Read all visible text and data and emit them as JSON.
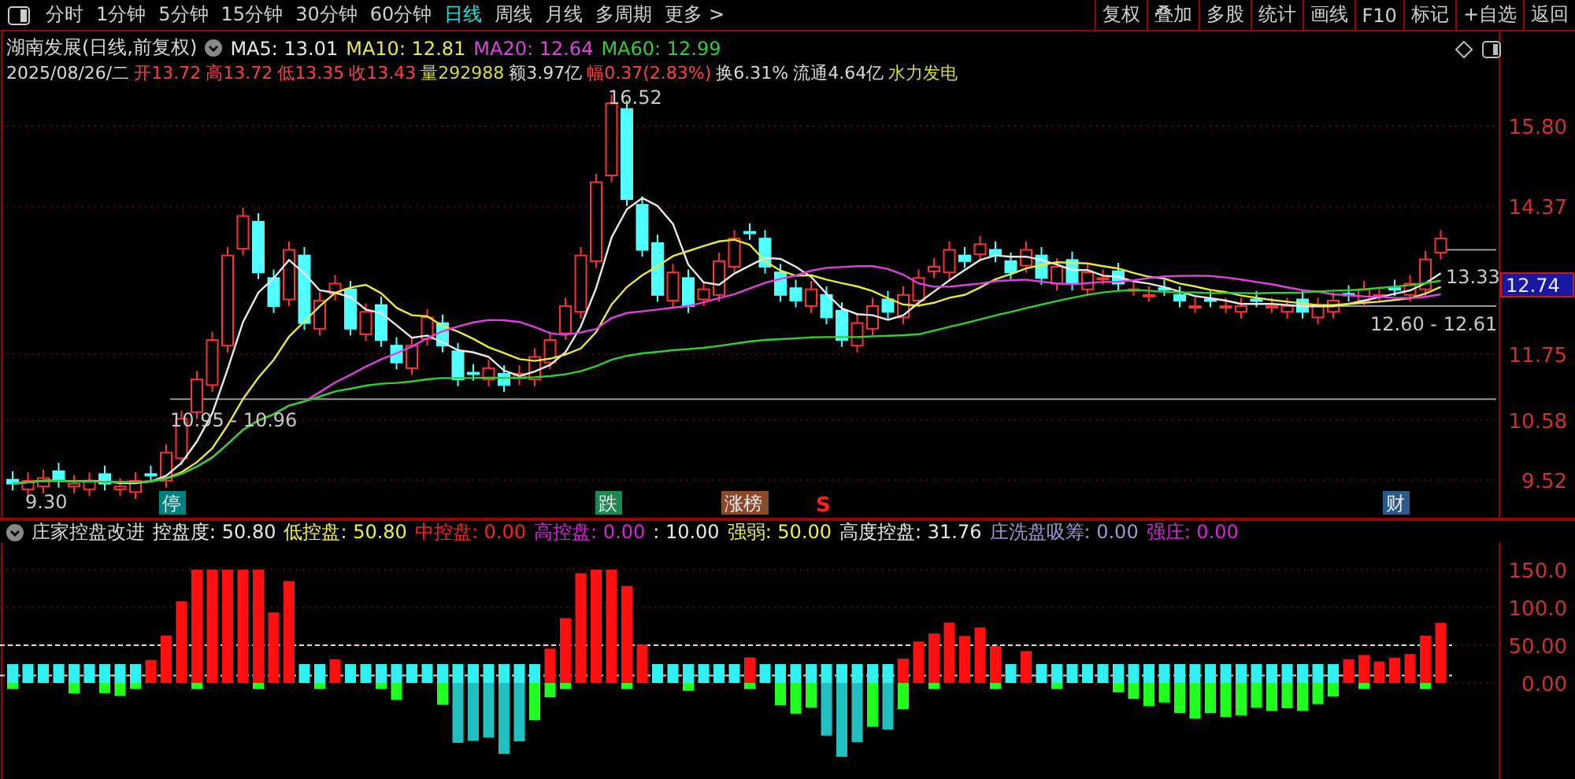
{
  "toolbar": {
    "tabs": [
      {
        "label": "分时",
        "selected": false
      },
      {
        "label": "1分钟",
        "selected": false
      },
      {
        "label": "5分钟",
        "selected": false
      },
      {
        "label": "15分钟",
        "selected": false
      },
      {
        "label": "30分钟",
        "selected": false
      },
      {
        "label": "60分钟",
        "selected": false
      },
      {
        "label": "日线",
        "selected": true
      },
      {
        "label": "周线",
        "selected": false
      },
      {
        "label": "月线",
        "selected": false
      },
      {
        "label": "多周期",
        "selected": false
      },
      {
        "label": "更多 >",
        "selected": false
      }
    ],
    "buttons": [
      "复权",
      "叠加",
      "多股",
      "统计",
      "画线",
      "F10",
      "标记",
      "+自选",
      "返回"
    ]
  },
  "quote": {
    "title": "湖南发展(日线,前复权)",
    "ma": [
      {
        "text": "MA5: 13.01",
        "color": "#e8e8e8"
      },
      {
        "text": "MA10: 12.81",
        "color": "#e8e840"
      },
      {
        "text": "MA20: 12.64",
        "color": "#e040e0"
      },
      {
        "text": "MA60: 12.99",
        "color": "#30d030"
      }
    ],
    "date": "2025/08/26/二",
    "fields": [
      {
        "text": "开13.72",
        "color": "#ff4040"
      },
      {
        "text": "高13.72",
        "color": "#ff4040"
      },
      {
        "text": "低13.35",
        "color": "#ff4040"
      },
      {
        "text": "收13.43",
        "color": "#ff4040"
      },
      {
        "text": "量292988",
        "color": "#d8d840"
      },
      {
        "text": "额3.97亿",
        "color": "#d8d8d8"
      },
      {
        "text": "幅0.37(2.83%)",
        "color": "#ff4040"
      },
      {
        "text": "换6.31%",
        "color": "#d8d8d8"
      },
      {
        "text": "流通4.64亿",
        "color": "#d8d8d8"
      },
      {
        "text": "水力发电",
        "color": "#d8d840"
      }
    ]
  },
  "price_chart": {
    "axis_labels": [
      "15.80",
      "14.37",
      "11.75",
      "10.58",
      "9.52"
    ],
    "current_price": "12.74",
    "annotations": [
      "16.52",
      "10.95 - 10.96",
      "12.60 - 12.61",
      "13.33",
      "9.30"
    ],
    "event_marks": [
      {
        "kind": "badge",
        "text": "停",
        "color": "#008080"
      },
      {
        "kind": "badge",
        "text": "跌",
        "color": "#1a8a50"
      },
      {
        "kind": "badge",
        "text": "涨榜",
        "color": "#8a4a2a"
      },
      {
        "kind": "letter",
        "text": "S",
        "color": "#ff2020"
      },
      {
        "kind": "badge",
        "text": "财",
        "color": "#2a5a8a"
      }
    ]
  },
  "indicator": {
    "name": "庄家控盘改进",
    "values": [
      {
        "text": "控盘度: 50.80",
        "color": "#e8e8e8"
      },
      {
        "text": "低控盘: 50.80",
        "color": "#f0f040"
      },
      {
        "text": "中控盘: 0.00",
        "color": "#ff2020"
      },
      {
        "text": "高控盘: 0.00",
        "color": "#e020e0"
      },
      {
        "text": ": 10.00",
        "color": "#e8e8e8"
      },
      {
        "text": "强弱: 50.00",
        "color": "#f0f040"
      },
      {
        "text": "高度控盘: 31.76",
        "color": "#e8e8e8"
      },
      {
        "text": "庄洗盘吸筹: 0.00",
        "color": "#9a9ad0"
      },
      {
        "text": "强庄: 0.00",
        "color": "#e020e0"
      }
    ],
    "axis_labels": [
      "150.0",
      "100.0",
      "50.00",
      "0.00"
    ]
  }
}
